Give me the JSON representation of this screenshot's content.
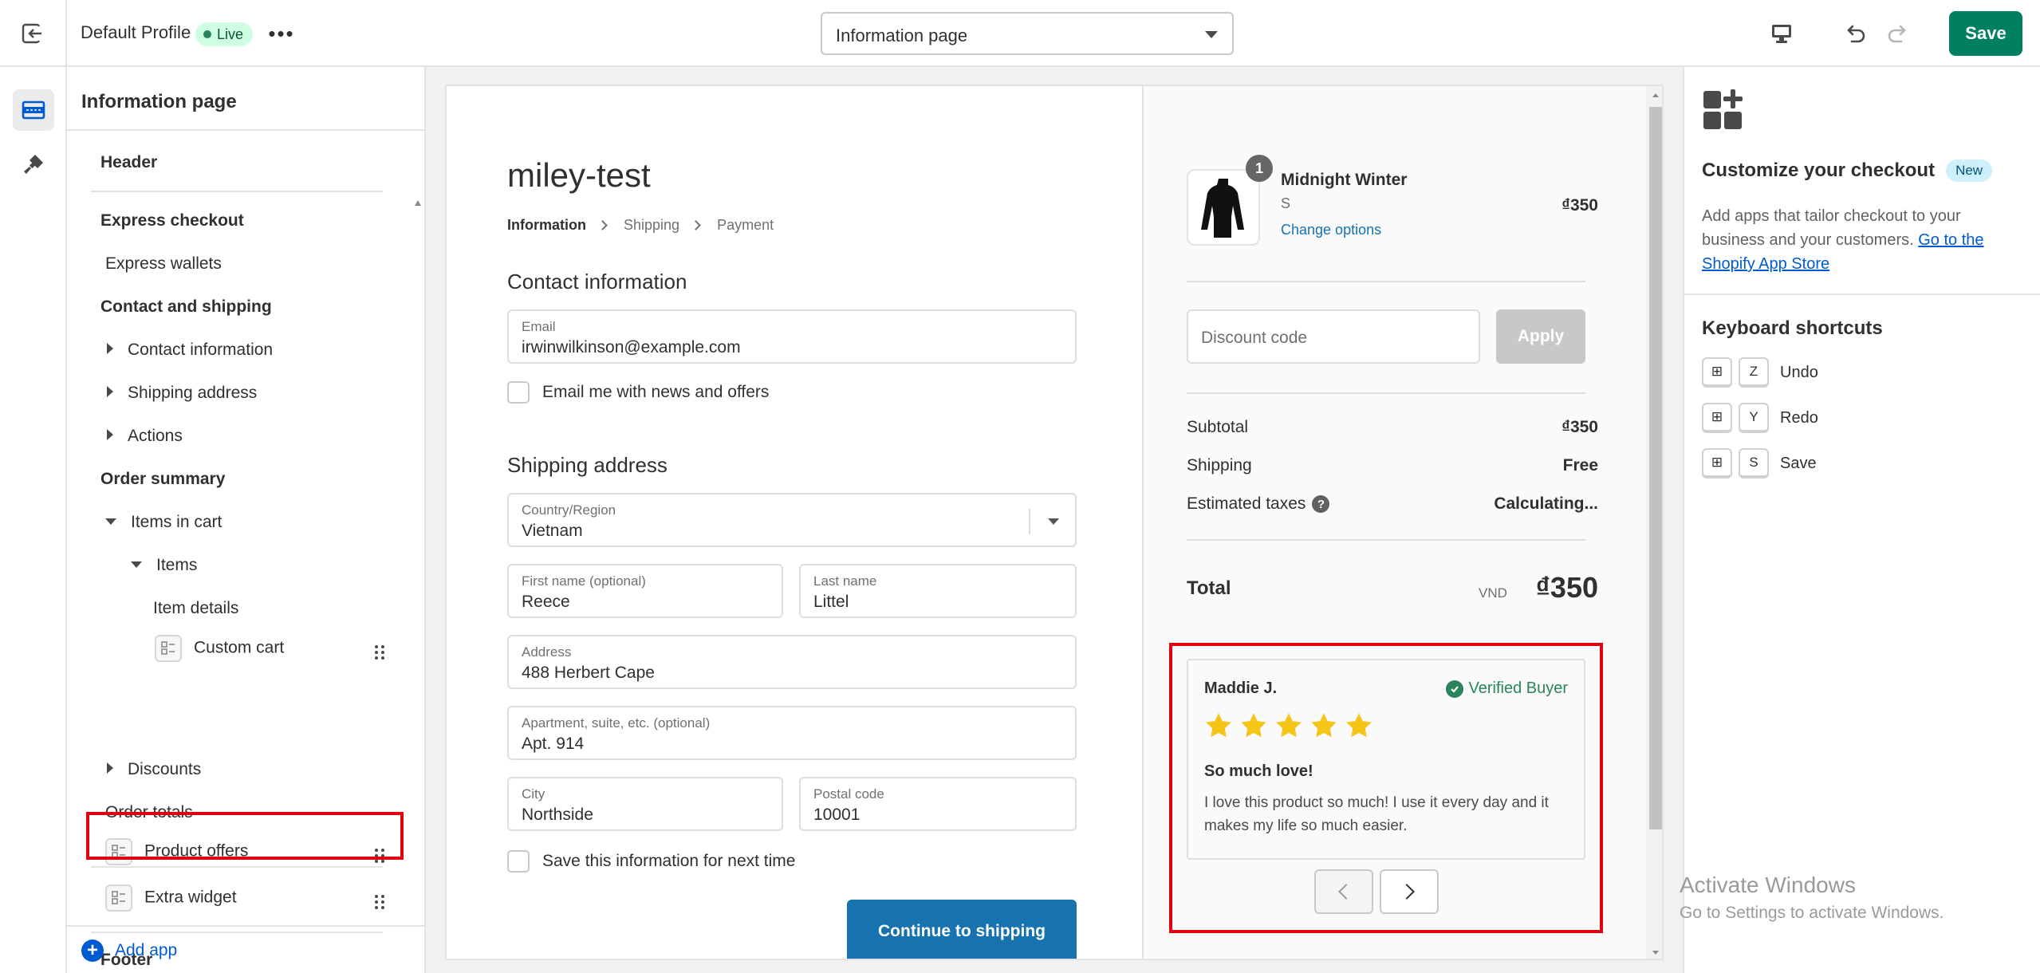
{
  "topbar": {
    "profile_name": "Default Profile",
    "live_label": "Live",
    "more_label": "•••",
    "page_select": "Information page",
    "save_label": "Save"
  },
  "left_panel": {
    "title": "Information page",
    "items": {
      "header": "Header",
      "express_checkout": "Express checkout",
      "express_wallets": "Express wallets",
      "contact_shipping": "Contact and shipping",
      "contact_information": "Contact information",
      "shipping_address": "Shipping address",
      "actions": "Actions",
      "order_summary": "Order summary",
      "items_in_cart": "Items in cart",
      "items": "Items",
      "item_details": "Item details",
      "custom_cart": "Custom cart",
      "discounts": "Discounts",
      "order_totals": "Order totals",
      "product_offers": "Product offers",
      "extra_widget": "Extra widget",
      "footer": "Footer"
    },
    "add_app": "Add app"
  },
  "checkout": {
    "shop_name": "miley-test",
    "breadcrumb": [
      "Information",
      "Shipping",
      "Payment"
    ],
    "contact_title": "Contact information",
    "email_label": "Email",
    "email_value": "irwinwilkinson@example.com",
    "newsletter_label": "Email me with news and offers",
    "shipping_title": "Shipping address",
    "country_label": "Country/Region",
    "country_value": "Vietnam",
    "first_name_label": "First name (optional)",
    "first_name_value": "Reece",
    "last_name_label": "Last name",
    "last_name_value": "Littel",
    "address_label": "Address",
    "address_value": "488 Herbert Cape",
    "apartment_label": "Apartment, suite, etc. (optional)",
    "apartment_value": "Apt. 914",
    "city_label": "City",
    "city_value": "Northside",
    "postal_label": "Postal code",
    "postal_value": "10001",
    "save_info_label": "Save this information for next time",
    "continue_label": "Continue to shipping"
  },
  "summary": {
    "product_name": "Midnight Winter",
    "product_variant": "S",
    "product_link": "Change options",
    "product_price": "₫350",
    "quantity": "1",
    "discount_placeholder": "Discount code",
    "apply_label": "Apply",
    "subtotal_label": "Subtotal",
    "subtotal_value": "₫350",
    "shipping_label": "Shipping",
    "shipping_value": "Free",
    "taxes_label": "Estimated taxes",
    "taxes_value": "Calculating...",
    "total_label": "Total",
    "total_currency": "VND",
    "total_value": "₫350"
  },
  "review": {
    "name": "Maddie J.",
    "verified": "Verified Buyer",
    "rating": 5,
    "title": "So much love!",
    "body": "I love this product so much! I use it every day and it makes my life so much easier."
  },
  "right_panel": {
    "title": "Customize your checkout",
    "new_badge": "New",
    "desc_text": "Add apps that tailor checkout to your business and your customers.",
    "desc_link": "Go to the Shopify App Store",
    "shortcuts_title": "Keyboard shortcuts",
    "shortcuts": [
      {
        "key": "Z",
        "label": "Undo"
      },
      {
        "key": "Y",
        "label": "Redo"
      },
      {
        "key": "S",
        "label": "Save"
      }
    ]
  },
  "watermark": {
    "line1": "Activate Windows",
    "line2": "Go to Settings to activate Windows."
  },
  "colors": {
    "brand_green": "#008060",
    "link_blue": "#005bd3",
    "checkout_blue": "#1773b0",
    "highlight_red": "#e0000f",
    "star_yellow": "#f5c518",
    "verified_green": "#29845a"
  }
}
